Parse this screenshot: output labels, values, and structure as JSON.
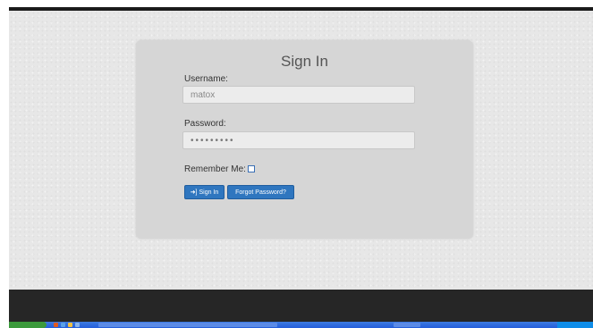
{
  "login": {
    "title": "Sign In",
    "username_label": "Username:",
    "username_value": "matox",
    "password_label": "Password:",
    "password_value": "•••••••••",
    "remember_label": "Remember Me:",
    "remember_checked": false,
    "signin_button": "Sign In",
    "signin_icon": "sign-in-icon",
    "forgot_button": "Forgot Password?"
  },
  "colors": {
    "primary_button": "#2f76bf",
    "panel_background": "#d6d6d6",
    "page_background": "#e7e7e7",
    "footer_background": "#262626",
    "taskbar_blue": "#245edb",
    "start_green": "#3c9a3c"
  },
  "taskbar": {
    "icons": [
      "start-button-icon",
      "browser-icon",
      "folder-icon",
      "media-icon"
    ]
  }
}
